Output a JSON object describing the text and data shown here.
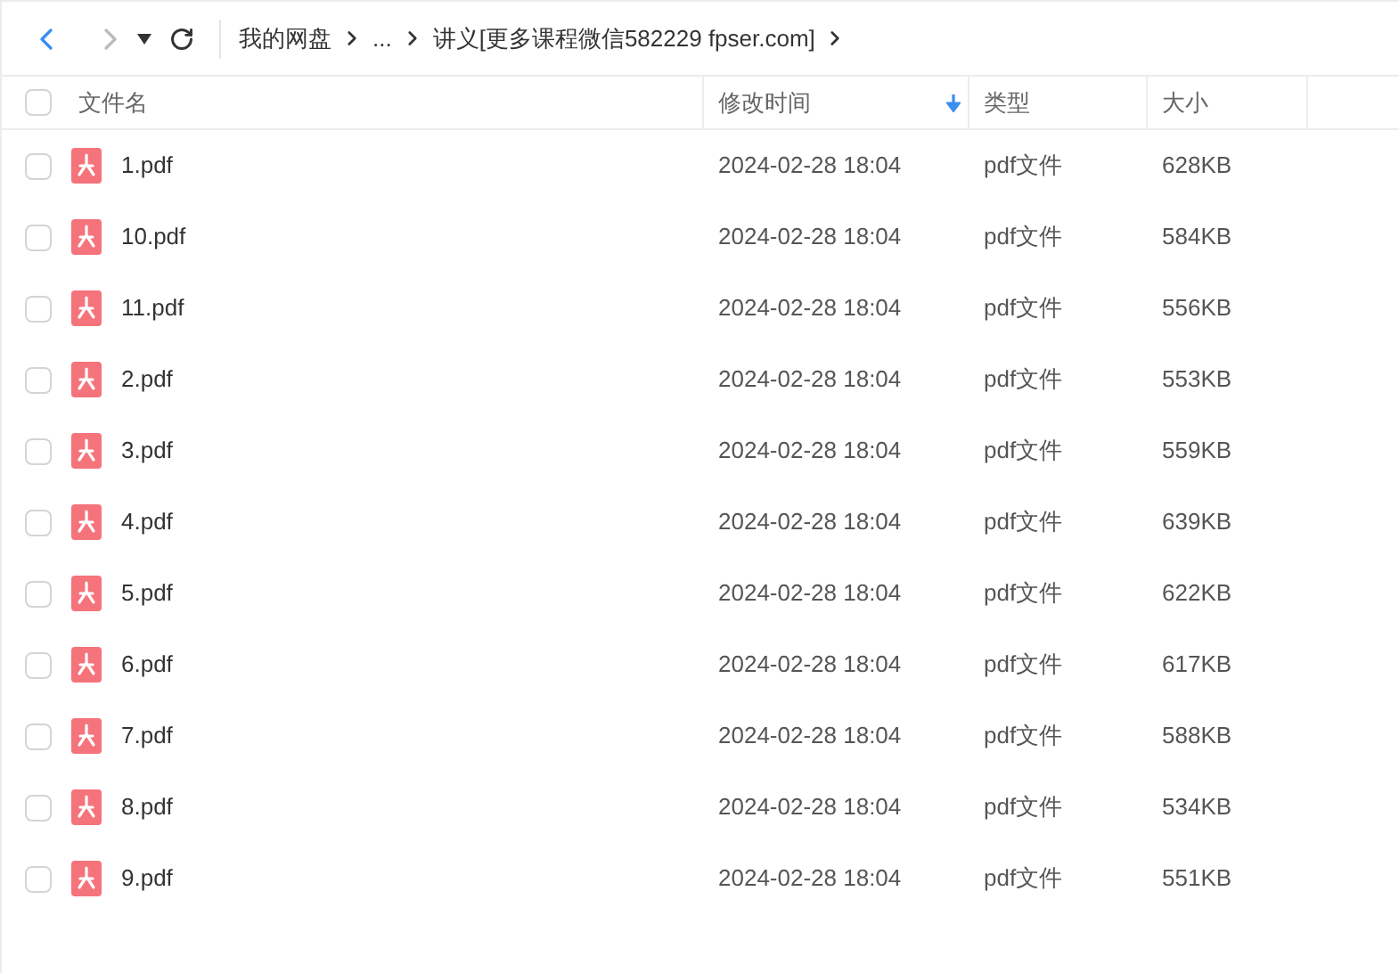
{
  "nav": {
    "back": {
      "disabled": false
    },
    "forward": {
      "disabled": true
    }
  },
  "breadcrumbs": [
    {
      "label": "我的网盘"
    },
    {
      "label": "..."
    },
    {
      "label": "讲义[更多课程微信582229 fpser.com]"
    }
  ],
  "columns": [
    {
      "label": "文件名",
      "sorted": false
    },
    {
      "label": "修改时间",
      "sorted": true
    },
    {
      "label": "类型",
      "sorted": false
    },
    {
      "label": "大小",
      "sorted": false
    }
  ],
  "select_all": {
    "checked": false
  },
  "rows": [
    {
      "name": "1.pdf",
      "modified": "2024-02-28 18:04",
      "type": "pdf文件",
      "size": "628KB",
      "checked": false
    },
    {
      "name": "10.pdf",
      "modified": "2024-02-28 18:04",
      "type": "pdf文件",
      "size": "584KB",
      "checked": false
    },
    {
      "name": "11.pdf",
      "modified": "2024-02-28 18:04",
      "type": "pdf文件",
      "size": "556KB",
      "checked": false
    },
    {
      "name": "2.pdf",
      "modified": "2024-02-28 18:04",
      "type": "pdf文件",
      "size": "553KB",
      "checked": false
    },
    {
      "name": "3.pdf",
      "modified": "2024-02-28 18:04",
      "type": "pdf文件",
      "size": "559KB",
      "checked": false
    },
    {
      "name": "4.pdf",
      "modified": "2024-02-28 18:04",
      "type": "pdf文件",
      "size": "639KB",
      "checked": false
    },
    {
      "name": "5.pdf",
      "modified": "2024-02-28 18:04",
      "type": "pdf文件",
      "size": "622KB",
      "checked": false
    },
    {
      "name": "6.pdf",
      "modified": "2024-02-28 18:04",
      "type": "pdf文件",
      "size": "617KB",
      "checked": false
    },
    {
      "name": "7.pdf",
      "modified": "2024-02-28 18:04",
      "type": "pdf文件",
      "size": "588KB",
      "checked": false
    },
    {
      "name": "8.pdf",
      "modified": "2024-02-28 18:04",
      "type": "pdf文件",
      "size": "534KB",
      "checked": false
    },
    {
      "name": "9.pdf",
      "modified": "2024-02-28 18:04",
      "type": "pdf文件",
      "size": "551KB",
      "checked": false
    }
  ]
}
